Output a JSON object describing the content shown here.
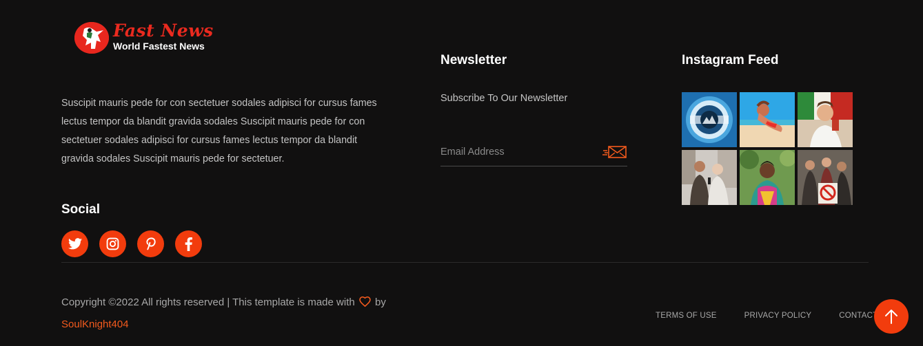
{
  "logo": {
    "title": "Fast News",
    "tagline": "World Fastest News"
  },
  "about": {
    "text": "Suscipit mauris pede for con sectetuer sodales adipisci for cursus fames lectus tempor da blandit gravida sodales Suscipit mauris pede for con sectetuer sodales adipisci for cursus fames lectus tempor da blandit gravida sodales Suscipit mauris pede for sectetuer."
  },
  "social": {
    "heading": "Social",
    "icons": [
      "twitter-icon",
      "instagram-icon",
      "pinterest-icon",
      "facebook-icon"
    ]
  },
  "newsletter": {
    "heading": "Newsletter",
    "subtitle": "Subscribe To Our Newsletter",
    "email_value": "",
    "email_placeholder": "Email Address",
    "send_icon": "envelope-send-icon"
  },
  "instagram": {
    "heading": "Instagram Feed"
  },
  "footer": {
    "copyright_before": "Copyright ©2022 All rights reserved | This template is made with",
    "copyright_after": "by",
    "author": "SoulKnight404",
    "links": [
      "TERMS OF USE",
      "PRIVACY POLICY",
      "CONTACT"
    ]
  },
  "back_to_top_icon": "arrow-up-icon",
  "colors": {
    "accent": "#f23c0d",
    "background": "#111010",
    "logo_red": "#ea2a1f"
  }
}
